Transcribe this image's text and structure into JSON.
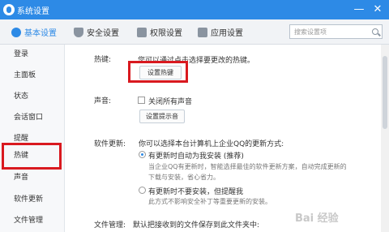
{
  "window": {
    "title": "系统设置",
    "minimize_symbol": "—",
    "close_symbol": "✕"
  },
  "tabs": [
    {
      "label": "基本设置",
      "icon": "gear-icon",
      "active": true
    },
    {
      "label": "安全设置",
      "icon": "shield-icon",
      "active": false
    },
    {
      "label": "权限设置",
      "icon": "lock-icon",
      "active": false
    },
    {
      "label": "应用设置",
      "icon": "apps-icon",
      "active": false
    }
  ],
  "search": {
    "placeholder": "搜索设置项"
  },
  "sidebar": {
    "items": [
      {
        "label": "登录",
        "active": false
      },
      {
        "label": "主面板",
        "active": false
      },
      {
        "label": "状态",
        "active": false
      },
      {
        "label": "会话窗口",
        "active": false
      },
      {
        "label": "提醒",
        "active": false
      },
      {
        "label": "热键",
        "active": true
      },
      {
        "label": "声音",
        "active": false
      },
      {
        "label": "软件更新",
        "active": false
      },
      {
        "label": "文件管理",
        "active": false
      }
    ]
  },
  "hotkeys": {
    "label": "热键:",
    "description": "您可以通过点击选择要更改的热键。",
    "button": "设置热键"
  },
  "sound": {
    "label": "声音:",
    "checkbox_label": "关闭所有声音",
    "button": "设置提示音"
  },
  "updates": {
    "label": "软件更新:",
    "description": "你可以选择本台计算机上企业QQ的更新方式:",
    "option1_label": "有更新时自动为我安装 (推荐)",
    "option1_desc_line1": "当企业QQ有更新时，智能选择最佳的软件更新方案，自动完成更新的",
    "option1_desc_line2": "下载与安装，省心省力。",
    "option2_label": "有更新时不要安装，但提醒我",
    "option2_desc": "此方式不影响安全补丁等重要更新的安装。"
  },
  "file_management": {
    "label": "文件管理:",
    "description": "默认把接收到的文件保存到此文件夹中:"
  },
  "watermark": {
    "text": "Bai 经验"
  },
  "colors": {
    "titlebar": "#2d8ae6",
    "highlight": "#d9191f",
    "accent": "#2d8ae6"
  }
}
